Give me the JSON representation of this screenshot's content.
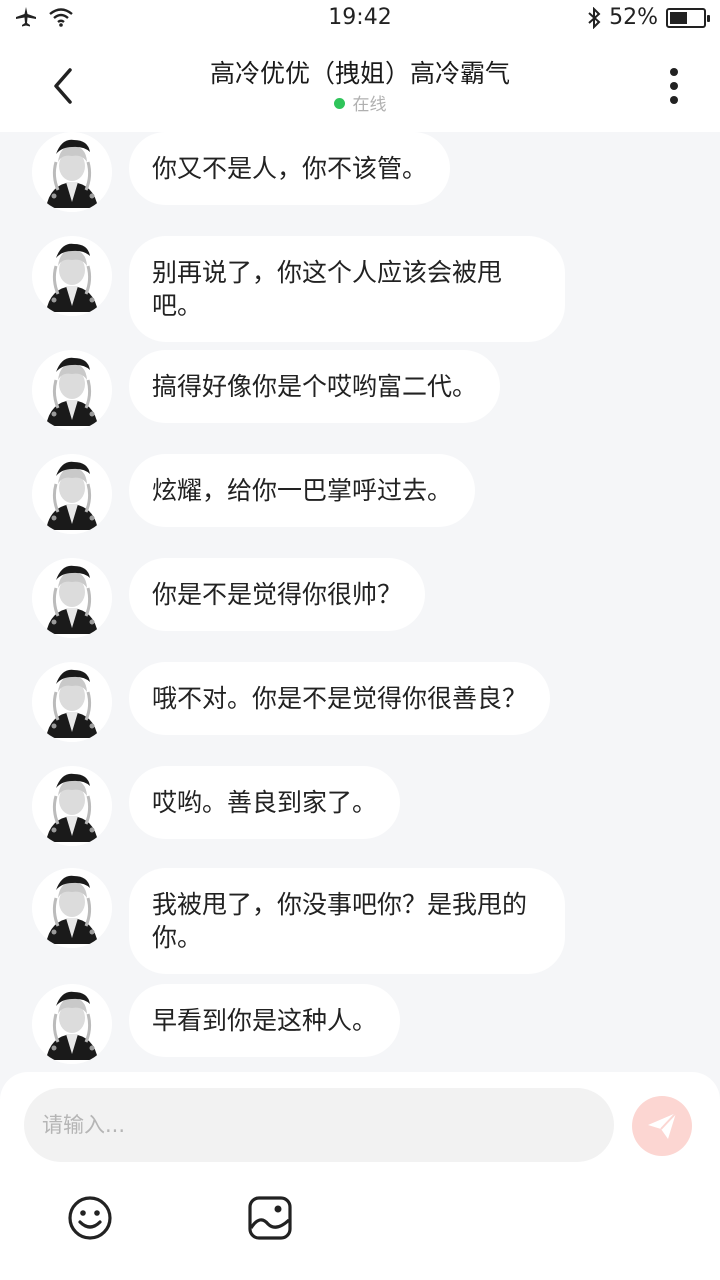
{
  "status_bar": {
    "time": "19:42",
    "battery_percent": "52%",
    "battery_level": 0.52,
    "icons": [
      "airplane-icon",
      "wifi-icon",
      "bluetooth-icon",
      "battery-icon"
    ]
  },
  "header": {
    "title": "高冷优优（拽姐）高冷霸气",
    "status": "在线",
    "status_color": "#2fc45a",
    "back_icon": "chevron-left-icon",
    "more_icon": "more-vertical-icon"
  },
  "messages": [
    {
      "text": "你又不是人，你不该管。"
    },
    {
      "text": "别再说了，你这个人应该会被甩吧。"
    },
    {
      "text": "搞得好像你是个哎哟富二代。"
    },
    {
      "text": "炫耀，给你一巴掌呼过去。"
    },
    {
      "text": "你是不是觉得你很帅？"
    },
    {
      "text": "哦不对。你是不是觉得你很善良？"
    },
    {
      "text": "哎哟。善良到家了。"
    },
    {
      "text": "我被甩了，你没事吧你？是我甩的你。"
    },
    {
      "text": "早看到你是这种人。"
    }
  ],
  "composer": {
    "placeholder": "请输入...",
    "value": "",
    "send_icon": "send-icon",
    "send_color": "#fcd6d2",
    "emoji_icon": "emoji-icon",
    "image_icon": "image-icon"
  }
}
